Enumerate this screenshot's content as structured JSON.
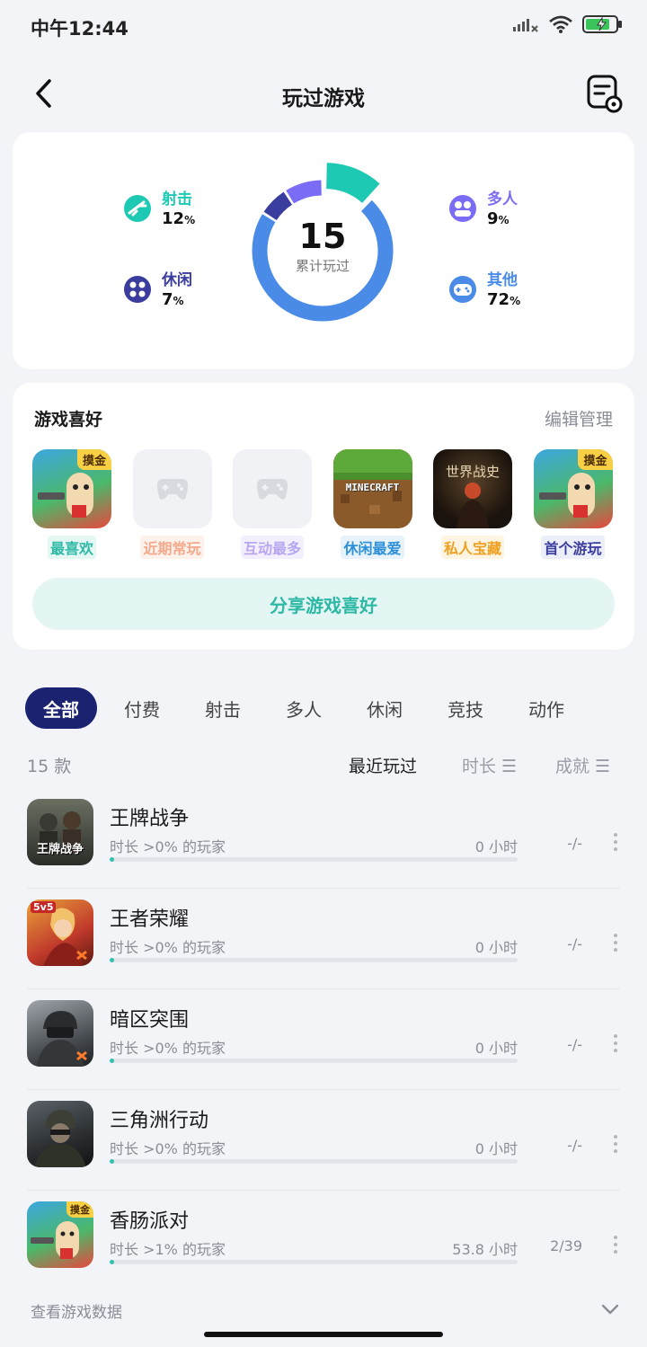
{
  "status_bar": {
    "time": "中午12:44"
  },
  "nav": {
    "title": "玩过游戏"
  },
  "stats": {
    "total": "15",
    "total_label": "累计玩过",
    "categories": [
      {
        "name": "射击",
        "pct": "12",
        "color": "#1ec9b4",
        "icon": "rifle-icon"
      },
      {
        "name": "休闲",
        "pct": "7",
        "color": "#3a3d9e",
        "icon": "ball-icon"
      },
      {
        "name": "多人",
        "pct": "9",
        "color": "#7b6cf6",
        "icon": "people-icon"
      },
      {
        "name": "其他",
        "pct": "72",
        "color": "#4a8be8",
        "icon": "gamepad-icon"
      }
    ],
    "pct_unit": "%"
  },
  "preferences": {
    "title": "游戏喜好",
    "manage": "编辑管理",
    "items": [
      {
        "label": "最喜欢",
        "color": "#2db9a5",
        "badge": "摸金",
        "thumb": "sausage"
      },
      {
        "label": "近期常玩",
        "color": "#f3a98c",
        "thumb": "empty"
      },
      {
        "label": "互动最多",
        "color": "#b9a6f2",
        "thumb": "empty"
      },
      {
        "label": "休闲最爱",
        "color": "#2d90d8",
        "thumb": "minecraft",
        "thumb_text": "MINECRAFT"
      },
      {
        "label": "私人宝藏",
        "color": "#f0a020",
        "thumb": "history",
        "thumb_text": "世界战史"
      },
      {
        "label": "首个游玩",
        "color": "#3a3d9e",
        "badge": "摸金",
        "thumb": "sausage"
      }
    ],
    "share": "分享游戏喜好"
  },
  "tabs": [
    "全部",
    "付费",
    "射击",
    "多人",
    "休闲",
    "竞技",
    "动作"
  ],
  "list": {
    "count": "15 款",
    "sort_recent": "最近玩过",
    "sort_time": "时长 ☰",
    "sort_ach": "成就 ☰",
    "games": [
      {
        "name": "王牌战争",
        "sub": "时长 >0% 的玩家",
        "hours": "0 小时",
        "ach": "-/-",
        "progress": 0.01,
        "icon_text": "王牌战争"
      },
      {
        "name": "王者荣耀",
        "sub": "时长 >0% 的玩家",
        "hours": "0 小时",
        "ach": "-/-",
        "progress": 0.01,
        "icon_text": "5v5"
      },
      {
        "name": "暗区突围",
        "sub": "时长 >0% 的玩家",
        "hours": "0 小时",
        "ach": "-/-",
        "progress": 0.01
      },
      {
        "name": "三角洲行动",
        "sub": "时长 >0% 的玩家",
        "hours": "0 小时",
        "ach": "-/-",
        "progress": 0.01
      },
      {
        "name": "香肠派对",
        "sub": "时长 >1% 的玩家",
        "hours": "53.8 小时",
        "ach": "2/39",
        "progress": 0.01,
        "badge": "摸金"
      }
    ]
  },
  "footer": {
    "link": "查看游戏数据"
  },
  "colors": {
    "accent": "#2cc4ad",
    "tab_active": "#1b2270",
    "donut_main": "#4a8be8"
  }
}
